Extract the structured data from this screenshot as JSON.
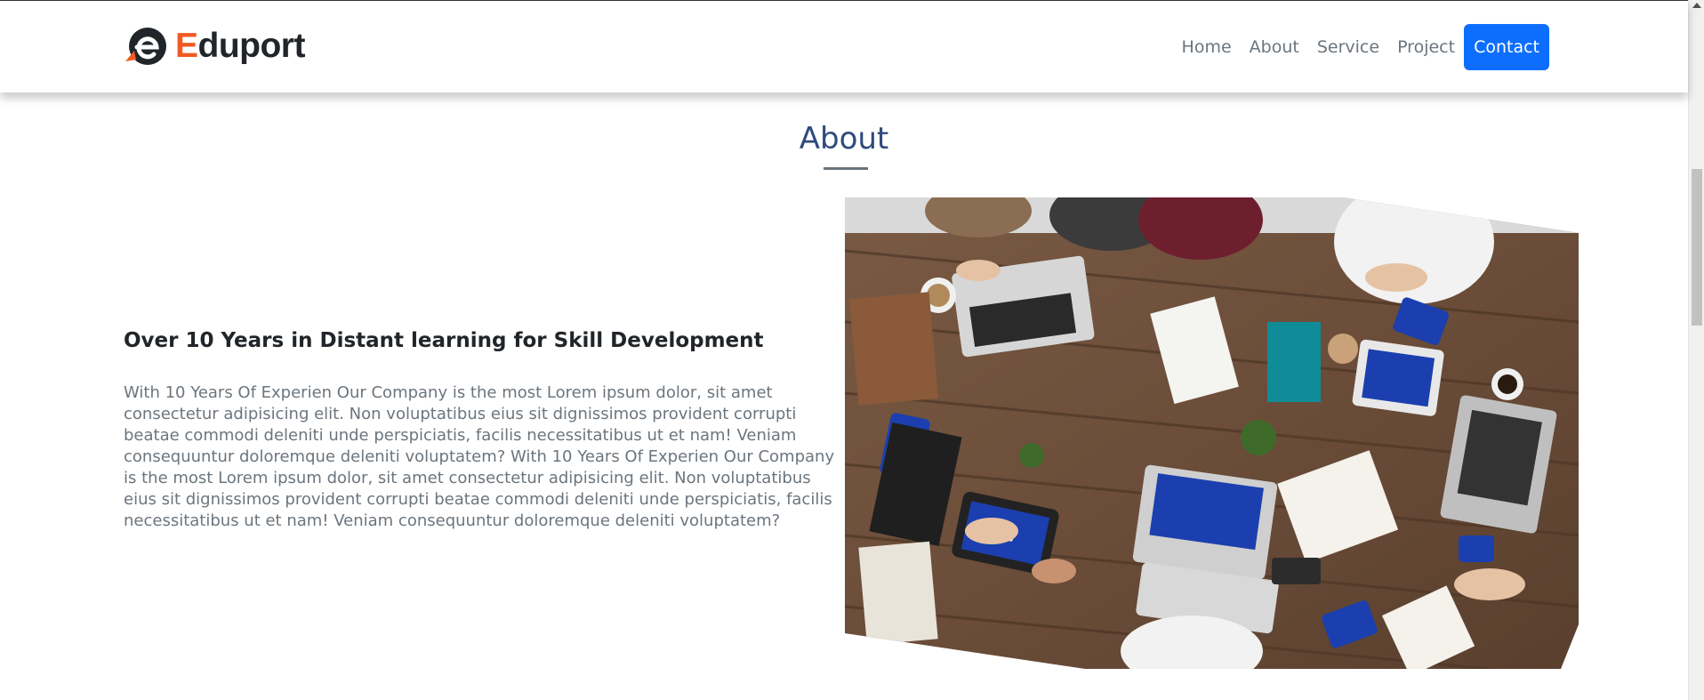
{
  "brand": {
    "initial": "E",
    "rest": "duport"
  },
  "nav": {
    "items": [
      "Home",
      "About",
      "Service",
      "Project"
    ],
    "contact": "Contact"
  },
  "section": {
    "title": "About"
  },
  "content": {
    "heading": "Over 10 Years in Distant learning for Skill Development",
    "body": "With 10 Years Of Experien Our Company is the most Lorem ipsum dolor, sit amet consectetur adipisicing elit. Non voluptatibus eius sit dignissimos provident corrupti beatae commodi deleniti unde perspiciatis, facilis necessitatibus ut et nam! Veniam consequuntur doloremque deleniti voluptatem? With 10 Years Of Experien Our Company is the most Lorem ipsum dolor, sit amet consectetur adipisicing elit. Non voluptatibus eius sit dignissimos provident corrupti beatae commodi deleniti unde perspiciatis, facilis necessitatibus ut et nam! Veniam consequuntur doloremque deleniti voluptatem?"
  },
  "colors": {
    "brand_accent": "#f15a22",
    "primary": "#0d6efd",
    "title": "#2f4a7c",
    "muted_text": "#6c757d"
  },
  "icons": {
    "logo": "eduport-e-logo-icon",
    "scroll_up": "scroll-up-arrow-icon"
  }
}
